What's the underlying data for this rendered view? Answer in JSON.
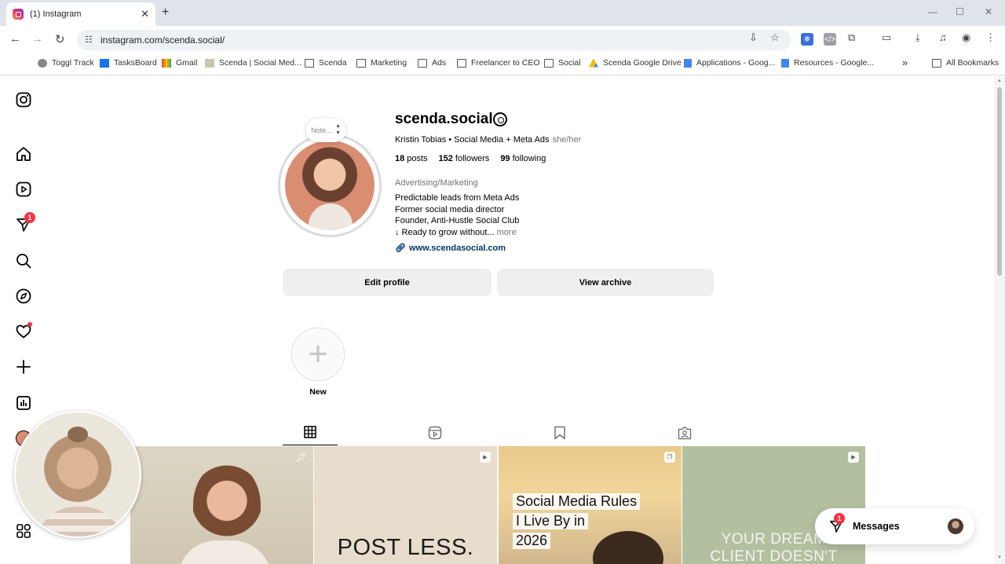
{
  "browser": {
    "tab_title": "(1) Instagram",
    "tab_close": "✕",
    "new_tab": "+",
    "url": "instagram.com/scenda.social/",
    "window_controls": [
      "—",
      "☐",
      "✕"
    ]
  },
  "bookmarks": [
    {
      "label": "Toggl Track",
      "icon": "toggl-icon"
    },
    {
      "label": "TasksBoard",
      "icon": "tasksboard-icon"
    },
    {
      "label": "Gmail",
      "icon": "gmail-icon"
    },
    {
      "label": "Scenda | Social Med...",
      "icon": "page-icon"
    },
    {
      "label": "Scenda",
      "icon": "folder-icon"
    },
    {
      "label": "Marketing",
      "icon": "folder-icon"
    },
    {
      "label": "Ads",
      "icon": "folder-icon"
    },
    {
      "label": "Freelancer to CEO",
      "icon": "folder-icon"
    },
    {
      "label": "Social",
      "icon": "folder-icon"
    },
    {
      "label": "Scenda Google Drive",
      "icon": "drive-icon"
    },
    {
      "label": "Applications - Goog...",
      "icon": "docs-icon"
    },
    {
      "label": "Resources - Google...",
      "icon": "docs-icon"
    }
  ],
  "bookmarks_overflow": "»",
  "all_bookmarks": "All Bookmarks",
  "sidebar": {
    "notification_badge": "1"
  },
  "profile": {
    "username": "scenda.social",
    "note_placeholder": "Note...",
    "full_name": "Kristin Tobias • Social Media + Meta Ads",
    "pronouns": "she/her",
    "posts_count": "18",
    "posts_label": "posts",
    "followers_count": "152",
    "followers_label": "followers",
    "following_count": "99",
    "following_label": "following",
    "category": "Advertising/Marketing",
    "bio_lines": [
      "Predictable leads from Meta Ads",
      "Former social media director",
      "Founder, Anti-Hustle Social Club",
      "↓ Ready to grow without..."
    ],
    "bio_more": "more",
    "website": "www.scendasocial.com",
    "edit_profile_label": "Edit profile",
    "view_archive_label": "View archive",
    "new_highlight_label": "New"
  },
  "posts": [
    {
      "caption": "",
      "kind": "pinned"
    },
    {
      "caption": "POST LESS.",
      "kind": "reel"
    },
    {
      "caption_lines": [
        "Social Media Rules",
        "I Live By in",
        "2026"
      ],
      "kind": "carousel"
    },
    {
      "caption_lines": [
        "YOUR DREAM",
        "CLIENT DOESN'T"
      ],
      "kind": "reel"
    }
  ],
  "messages": {
    "label": "Messages",
    "badge": "1"
  },
  "colors": {
    "badge_red": "#ff3040",
    "link_blue": "#00376b",
    "button_gray": "#efefef"
  }
}
